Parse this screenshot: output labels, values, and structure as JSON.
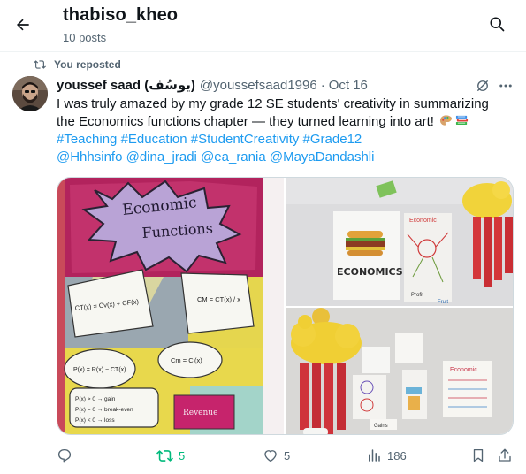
{
  "header": {
    "title": "thabiso_kheo",
    "subtitle": "10 posts"
  },
  "repost": {
    "label": "You reposted"
  },
  "post": {
    "author_name": "youssef saad (يوسُف)",
    "author_handle": "@youssefsaad1996",
    "date": "Oct 16",
    "text_line1": "I was truly amazed by my grade 12 SE students' creativity in summarizing",
    "text_line2": "the Economics functions chapter — they turned learning into art!",
    "hashtags": [
      "#Teaching",
      "#Education",
      "#StudentCreativity",
      "#Grade12"
    ],
    "mentions": [
      "@Hhhsinfo",
      "@dina_jradi",
      "@ea_rania",
      "@MayaDandashli"
    ]
  },
  "media": {
    "image1": {
      "title_line1": "Economic",
      "title_line2": "Functions",
      "formula_total_cost": "CT(x) = Cv(x) + CF(x)",
      "formula_avg_cost": "CM = CT(x) / x",
      "formula_profit": "P(x) = R(x) − CT(x)",
      "formula_marginal": "Cm = C'(x)",
      "rule_gain": "P(x) > 0 → gain",
      "rule_break_even": "P(x) = 0 → break-even",
      "rule_loss": "P(x) < 0 → loss",
      "revenue_label": "Revenue"
    },
    "image2": {
      "poster_title": "ECONOMICS",
      "map_title": "Economic",
      "side_label": "Profit",
      "fruit_label": "Fruit"
    },
    "image3": {
      "poster_title": "Economic",
      "card_label": "Gains"
    }
  },
  "actions": {
    "replies": "",
    "reposts": "5",
    "likes": "5",
    "views": "186"
  },
  "colors": {
    "link": "#1d9bf0",
    "repost_active": "#00ba7c",
    "secondary_text": "#536471"
  }
}
